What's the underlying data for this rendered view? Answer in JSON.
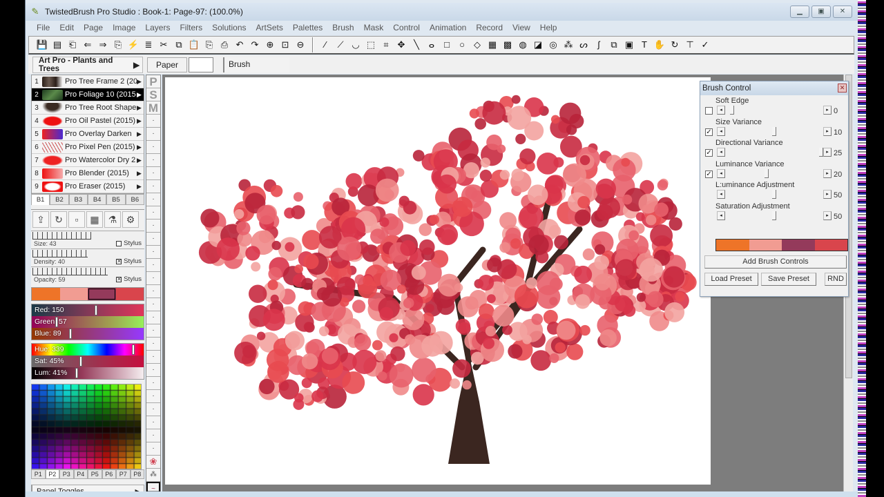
{
  "window": {
    "title": "TwistedBrush Pro Studio : Book-1: Page-97:  (100.0%)",
    "controls": [
      "minimize",
      "maximize",
      "close"
    ]
  },
  "menu": [
    "File",
    "Edit",
    "Page",
    "Image",
    "Layers",
    "Filters",
    "Solutions",
    "ArtSets",
    "Palettes",
    "Brush",
    "Mask",
    "Control",
    "Animation",
    "Record",
    "View",
    "Help"
  ],
  "toolbar": {
    "file_tools": [
      {
        "name": "save-icon",
        "glyph": "💾"
      },
      {
        "name": "book-icon",
        "glyph": "▤"
      },
      {
        "name": "page-first-icon",
        "glyph": "⎗"
      },
      {
        "name": "page-prev-icon",
        "glyph": "⇐"
      },
      {
        "name": "page-next-icon",
        "glyph": "⇒"
      },
      {
        "name": "page-last-icon",
        "glyph": "⎘"
      },
      {
        "name": "effect-icon",
        "glyph": "⚡"
      },
      {
        "name": "layers-icon",
        "glyph": "≣"
      },
      {
        "name": "cut-icon",
        "glyph": "✂"
      },
      {
        "name": "copy-icon",
        "glyph": "⧉"
      },
      {
        "name": "paste-icon",
        "glyph": "📋"
      },
      {
        "name": "copy-layer-icon",
        "glyph": "⎘"
      },
      {
        "name": "paste-layer-icon",
        "glyph": "⎙"
      },
      {
        "name": "undo-icon",
        "glyph": "↶"
      },
      {
        "name": "redo-icon",
        "glyph": "↷"
      },
      {
        "name": "zoom-in-icon",
        "glyph": "⊕"
      },
      {
        "name": "actual-size-icon",
        "glyph": "⊡"
      },
      {
        "name": "zoom-out-icon",
        "glyph": "⊖"
      }
    ],
    "draw_tools": [
      {
        "name": "brush-icon",
        "glyph": "⁄"
      },
      {
        "name": "eyedropper-icon",
        "glyph": "⟋"
      },
      {
        "name": "bucket-icon",
        "glyph": "◡"
      },
      {
        "name": "marquee-icon",
        "glyph": "⬚"
      },
      {
        "name": "crop-icon",
        "glyph": "⌗"
      },
      {
        "name": "move-icon",
        "glyph": "✥"
      },
      {
        "name": "line-icon",
        "glyph": "╲"
      },
      {
        "name": "lasso-icon",
        "glyph": "ⴰ"
      },
      {
        "name": "rectangle-icon",
        "glyph": "□"
      },
      {
        "name": "ellipse-icon",
        "glyph": "○"
      },
      {
        "name": "fill-icon",
        "glyph": "◇"
      },
      {
        "name": "gradient-icon",
        "glyph": "▦"
      },
      {
        "name": "pattern-icon",
        "glyph": "▩"
      },
      {
        "name": "texture-icon",
        "glyph": "◍"
      },
      {
        "name": "mask-icon",
        "glyph": "◪"
      },
      {
        "name": "mask-pattern-icon",
        "glyph": "◎"
      },
      {
        "name": "spray-icon",
        "glyph": "⁂"
      },
      {
        "name": "smudge-icon",
        "glyph": "ᔕ"
      },
      {
        "name": "script-icon",
        "glyph": "ʃ"
      },
      {
        "name": "stamp-copy-icon",
        "glyph": "⧉"
      },
      {
        "name": "stamp-paste-icon",
        "glyph": "▣"
      },
      {
        "name": "text-icon",
        "glyph": "T"
      },
      {
        "name": "hand-icon",
        "glyph": "✋"
      },
      {
        "name": "rotate-icon",
        "glyph": "↻"
      },
      {
        "name": "pin-icon",
        "glyph": "⊤"
      },
      {
        "name": "magic-brush-icon",
        "glyph": "✓"
      }
    ]
  },
  "subbar": {
    "artset": "Art Pro - Plants and Trees",
    "paper_label": "Paper",
    "brush_label": "Brush"
  },
  "brushes": [
    {
      "num": "1",
      "name": "Pro Tree Frame 2 (20",
      "thumb": "linear-gradient(90deg,#2a1e18,#6a5a50,#2a1e18,#fff)",
      "selected": false
    },
    {
      "num": "2",
      "name": "Pro Foliage 10 (2015",
      "thumb": "linear-gradient(135deg,#1e3a1e,#5a8a4a,#1e3a1e)",
      "selected": true
    },
    {
      "num": "3",
      "name": "Pro Tree Root Shape",
      "thumb": "radial-gradient(ellipse at 50% 30%,#3a2a22 40%,transparent 70%)",
      "selected": false
    },
    {
      "num": "4",
      "name": "Pro Oil Pastel (2015)",
      "thumb": "radial-gradient(ellipse,#ee1111 55%,transparent 70%)",
      "selected": false
    },
    {
      "num": "5",
      "name": "Pro Overlay Darken",
      "thumb": "linear-gradient(90deg,#e22,#4a2ad0)",
      "selected": false
    },
    {
      "num": "6",
      "name": "Pro Pixel Pen (2015)",
      "thumb": "repeating-linear-gradient(60deg,transparent 0 3px,#c55 3px 4px)",
      "selected": false
    },
    {
      "num": "7",
      "name": "Pro Watercolor Dry 2",
      "thumb": "radial-gradient(ellipse,#ee2222 55%,transparent 72%)",
      "selected": false
    },
    {
      "num": "8",
      "name": "Pro Blender (2015)",
      "thumb": "linear-gradient(90deg,#e11,#f5aaaa)",
      "selected": false
    },
    {
      "num": "9",
      "name": "Pro Eraser (2015)",
      "thumb": "radial-gradient(ellipse,#fff 45%,#e11 60%)",
      "selected": false
    }
  ],
  "brush_tabs": [
    "B1",
    "B2",
    "B3",
    "B4",
    "B5",
    "B6"
  ],
  "brush_tab_active": "B1",
  "brush_tools": [
    {
      "name": "load-brush-icon",
      "glyph": "⇪"
    },
    {
      "name": "reset-brush-icon",
      "glyph": "↻"
    },
    {
      "name": "brush-steps-icon",
      "glyph": "▫"
    },
    {
      "name": "brush-paper-icon",
      "glyph": "▦"
    },
    {
      "name": "brush-spray-icon",
      "glyph": "⚗"
    },
    {
      "name": "brush-settings-icon",
      "glyph": "⚙"
    }
  ],
  "brush_settings": {
    "size": {
      "label": "Size: 43",
      "value": 43,
      "stylus": false
    },
    "density": {
      "label": "Density: 40",
      "value": 40,
      "stylus": true
    },
    "opacity": {
      "label": "Opacity: 59",
      "value": 59,
      "stylus": true
    },
    "stylus_label": "Stylus"
  },
  "palette_colors": [
    "#ee7428",
    "#f19c92",
    "#943a5b",
    "#d9454c"
  ],
  "palette_selected_index": 2,
  "color_sliders": {
    "rgb": [
      {
        "label": "Red: 150",
        "value": 150,
        "max": 255,
        "bg": "linear-gradient(90deg,#1a3a48,#96395a 60%,#e0355a)"
      },
      {
        "label": "Green: 57",
        "value": 57,
        "max": 255,
        "bg": "linear-gradient(90deg,#96005a,#a0a050 70%,#96f05a)"
      },
      {
        "label": "Blue: 89",
        "value": 89,
        "max": 255,
        "bg": "linear-gradient(90deg,#963900,#963990 60%,#9639ff)"
      }
    ],
    "hsl": [
      {
        "label": "Hue: 339",
        "value": 339,
        "max": 360,
        "bg": "linear-gradient(90deg,#f00,#ff0 17%,#0f0 33%,#0ff 50%,#00f 67%,#f0f 83%,#f00)"
      },
      {
        "label": "Sat: 45%",
        "value": 45,
        "max": 100,
        "bg": "linear-gradient(90deg,#6a6a6a,#a0304e 60%,#c5103f)"
      },
      {
        "label": "Lum: 41%",
        "value": 41,
        "max": 100,
        "bg": "linear-gradient(90deg,#000,#963a5a 45%,#f5eef0)"
      }
    ]
  },
  "palette_tabs": [
    "P1",
    "P2",
    "P3",
    "P4",
    "P5",
    "P6",
    "P7",
    "P8"
  ],
  "palette_tab_active": "P2",
  "panel_toggles_label": "Panel Toggles",
  "psm": [
    "P",
    "S",
    "M"
  ],
  "brush_control": {
    "title": "Brush Control",
    "rows": [
      {
        "label": "Soft Edge",
        "checkbox": true,
        "checked": false,
        "value": "0",
        "fraction": 0.05
      },
      {
        "label": "Size Variance",
        "checkbox": true,
        "checked": true,
        "value": "10",
        "fraction": 0.5
      },
      {
        "label": "Directional Variance",
        "checkbox": true,
        "checked": true,
        "value": "25",
        "fraction": 1.0
      },
      {
        "label": "Luminance Variance",
        "checkbox": true,
        "checked": true,
        "value": "20",
        "fraction": 0.42
      },
      {
        "label": "L:uminance Adjustment",
        "checkbox": false,
        "checked": false,
        "value": "50",
        "fraction": 0.5
      },
      {
        "label": "Saturation Adjustment",
        "checkbox": false,
        "checked": false,
        "value": "50",
        "fraction": 0.5
      }
    ],
    "palette": [
      "#ee7428",
      "#f19c92",
      "#943a5b",
      "#d9454c"
    ],
    "add_brush_controls": "Add Brush Controls",
    "load_preset": "Load Preset",
    "save_preset": "Save Preset",
    "rnd": "RND"
  }
}
